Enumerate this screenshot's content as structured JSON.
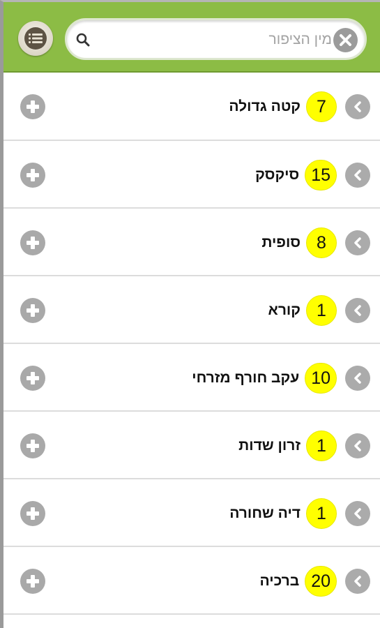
{
  "search": {
    "placeholder": "מין הציפור",
    "value": ""
  },
  "colors": {
    "header": "#8cbc45",
    "badge": "#ffff00",
    "icon_gray": "#a9a9a9"
  },
  "icons": {
    "menu": "list-icon",
    "search": "search-icon",
    "clear": "clear-x-icon",
    "add": "plus-icon",
    "open": "chevron-left-icon"
  },
  "birds": [
    {
      "name": "קטה גדולה",
      "count": "7"
    },
    {
      "name": "סיקסק",
      "count": "15"
    },
    {
      "name": "סופית",
      "count": "8"
    },
    {
      "name": "קורא",
      "count": "1"
    },
    {
      "name": "עקב חורף מזרחי",
      "count": "10"
    },
    {
      "name": "זרון שדות",
      "count": "1"
    },
    {
      "name": "דיה שחורה",
      "count": "1"
    },
    {
      "name": "ברכיה",
      "count": "20"
    }
  ]
}
